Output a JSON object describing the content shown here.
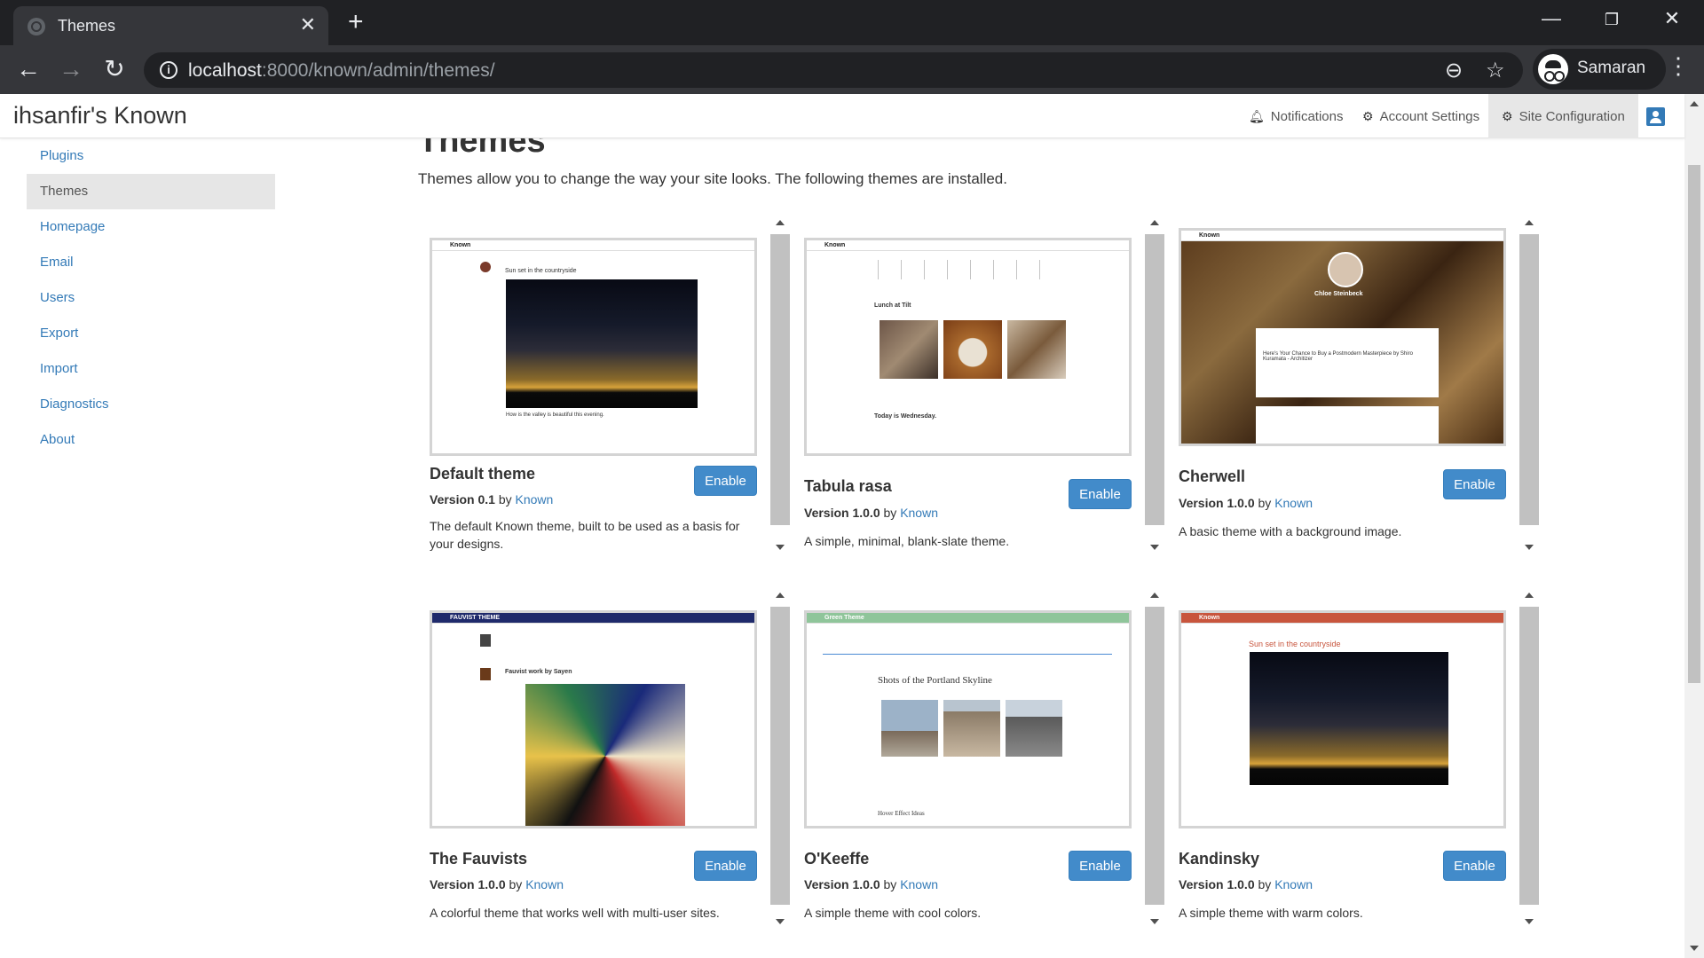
{
  "browser": {
    "tab_title": "Themes",
    "url_host": "localhost",
    "url_path": ":8000/known/admin/themes/",
    "profile_name": "Samaran",
    "icons": [
      "globe-icon",
      "close-icon",
      "plus-icon",
      "back-icon",
      "forward-icon",
      "reload-icon",
      "info-icon",
      "zoom-out-icon",
      "star-icon",
      "incognito-avatar-icon",
      "more-vert-icon",
      "minimize-icon",
      "restore-icon",
      "window-close-icon"
    ]
  },
  "site": {
    "brand": "ihsanfir's Known",
    "nav": {
      "notifications": "Notifications",
      "account_settings": "Account Settings",
      "site_configuration": "Site Configuration"
    }
  },
  "sidebar": {
    "items": [
      {
        "label": "Plugins"
      },
      {
        "label": "Themes"
      },
      {
        "label": "Homepage"
      },
      {
        "label": "Email"
      },
      {
        "label": "Users"
      },
      {
        "label": "Export"
      },
      {
        "label": "Import"
      },
      {
        "label": "Diagnostics"
      },
      {
        "label": "About"
      }
    ],
    "active": "Themes"
  },
  "page": {
    "title": "Themes",
    "intro": "Themes allow you to change the way your site looks. The following themes are installed."
  },
  "themes": [
    {
      "name": "Default theme",
      "version_label": "Version 0.1",
      "by": "by",
      "author": "Known",
      "description": "The default Known theme, built to be used as a basis for your designs.",
      "button": "Enable",
      "preview": {
        "header": "Known",
        "post_title": "Sun set in the countryside",
        "caption": "How is the valley is beautiful this evening."
      }
    },
    {
      "name": "Tabula rasa",
      "version_label": "Version 1.0.0",
      "by": "by",
      "author": "Known",
      "description": "A simple, minimal, blank-slate theme.",
      "button": "Enable",
      "preview": {
        "header": "Known",
        "post_title": "Lunch at Tilt",
        "post_title_2": "Today is Wednesday."
      }
    },
    {
      "name": "Cherwell",
      "version_label": "Version 1.0.0",
      "by": "by",
      "author": "Known",
      "description": "A basic theme with a background image.",
      "button": "Enable",
      "preview": {
        "header": "Known",
        "profile_name": "Chloe Steinbeck",
        "post_title": "Here's Your Chance to Buy a Postmodern Masterpiece by Shiro Kuramata - Architizer"
      }
    },
    {
      "name": "The Fauvists",
      "version_label": "Version 1.0.0",
      "by": "by",
      "author": "Known",
      "description": "A colorful theme that works well with multi-user sites.",
      "button": "Enable",
      "preview": {
        "header": "FAUVIST THEME",
        "post_title": "Fauvist work by Sayen"
      }
    },
    {
      "name": "O'Keeffe",
      "version_label": "Version 1.0.0",
      "by": "by",
      "author": "Known",
      "description": "A simple theme with cool colors.",
      "button": "Enable",
      "preview": {
        "header": "Green Theme",
        "post_title": "Shots of the Portland Skyline",
        "post_title_2": "Hover Effect Ideas"
      }
    },
    {
      "name": "Kandinsky",
      "version_label": "Version 1.0.0",
      "by": "by",
      "author": "Known",
      "description": "A simple theme with warm colors.",
      "button": "Enable",
      "preview": {
        "header": "Known",
        "post_title": "Sun set in the countryside"
      }
    }
  ],
  "colors": {
    "link": "#337ab7",
    "button": "#428bca",
    "chrome_dark": "#202124",
    "chrome_toolbar": "#35363a"
  }
}
